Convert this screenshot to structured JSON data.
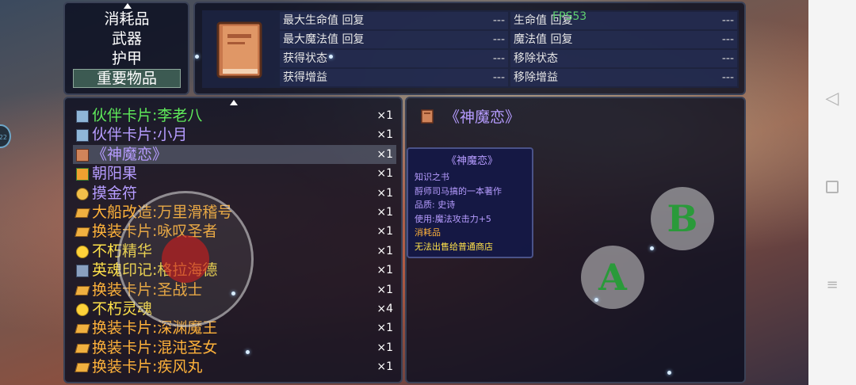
{
  "categories": [
    {
      "label": "消耗品",
      "selected": false
    },
    {
      "label": "武器",
      "selected": false
    },
    {
      "label": "护甲",
      "selected": false
    },
    {
      "label": "重要物品",
      "selected": true
    }
  ],
  "stats": {
    "left": [
      {
        "label": "最大生命值 回复",
        "value": "---"
      },
      {
        "label": "最大魔法值 回复",
        "value": "---"
      },
      {
        "label": "获得状态",
        "value": "---"
      },
      {
        "label": "获得增益",
        "value": "---"
      }
    ],
    "right": [
      {
        "label": "生命值 回复",
        "value": "---"
      },
      {
        "label": "魔法值 回复",
        "value": "---"
      },
      {
        "label": "移除状态",
        "value": "---"
      },
      {
        "label": "移除增益",
        "value": "---"
      }
    ],
    "fps": "FPS53"
  },
  "items": [
    {
      "name": "伙伴卡片:李老八",
      "qty": "×1",
      "color": "#5ee85a",
      "icon": "card-icon",
      "selected": false
    },
    {
      "name": "伙伴卡片:小月",
      "qty": "×1",
      "color": "#b69cff",
      "icon": "card-icon",
      "selected": false
    },
    {
      "name": "《神魔恋》",
      "qty": "×1",
      "color": "#b69cff",
      "icon": "book-icon",
      "selected": true
    },
    {
      "name": "朝阳果",
      "qty": "×1",
      "color": "#b69cff",
      "icon": "fruit-icon",
      "selected": false
    },
    {
      "name": "摸金符",
      "qty": "×1",
      "color": "#b69cff",
      "icon": "charm-icon",
      "selected": false
    },
    {
      "name": "大船改造:万里滑稽号",
      "qty": "×1",
      "color": "#ffb23a",
      "icon": "ticket-icon",
      "selected": false
    },
    {
      "name": "换装卡片:咏叹圣者",
      "qty": "×1",
      "color": "#ffb23a",
      "icon": "ticket-icon",
      "selected": false
    },
    {
      "name": "不朽精华",
      "qty": "×1",
      "color": "#ffe24a",
      "icon": "orb-icon",
      "selected": false
    },
    {
      "name": "英魂印记:格拉海德",
      "qty": "×1",
      "color": "#ffe24a",
      "icon": "seal-icon",
      "selected": false
    },
    {
      "name": "换装卡片:圣战士",
      "qty": "×1",
      "color": "#ffb23a",
      "icon": "ticket-icon",
      "selected": false
    },
    {
      "name": "不朽灵魂",
      "qty": "×4",
      "color": "#ffe24a",
      "icon": "orb-icon",
      "selected": false
    },
    {
      "name": "换装卡片:深渊魔王",
      "qty": "×1",
      "color": "#ffb23a",
      "icon": "ticket-icon",
      "selected": false
    },
    {
      "name": "换装卡片:混沌圣女",
      "qty": "×1",
      "color": "#ffb23a",
      "icon": "ticket-icon",
      "selected": false
    },
    {
      "name": "换装卡片:疾风丸",
      "qty": "×1",
      "color": "#ffb23a",
      "icon": "ticket-icon",
      "selected": false
    }
  ],
  "detail": {
    "title": "《神魔恋》",
    "tooltip": {
      "title": "《神魔恋》",
      "lines": [
        {
          "text": "知识之书",
          "color": "#b69cff"
        },
        {
          "text": "酹师司马搞的一本著作",
          "color": "#b69cff"
        },
        {
          "text": "品质: 史诗",
          "color": "#b69cff"
        },
        {
          "text": "使用:魔法攻击力+5",
          "color": "#b69cff"
        },
        {
          "text": "消耗品",
          "color": "#ffb23a"
        },
        {
          "text": "无法出售给普通商店",
          "color": "#ffe24a"
        }
      ]
    }
  },
  "controls": {
    "a_label": "A",
    "b_label": "B"
  },
  "status": {
    "edge_badge": "22"
  }
}
